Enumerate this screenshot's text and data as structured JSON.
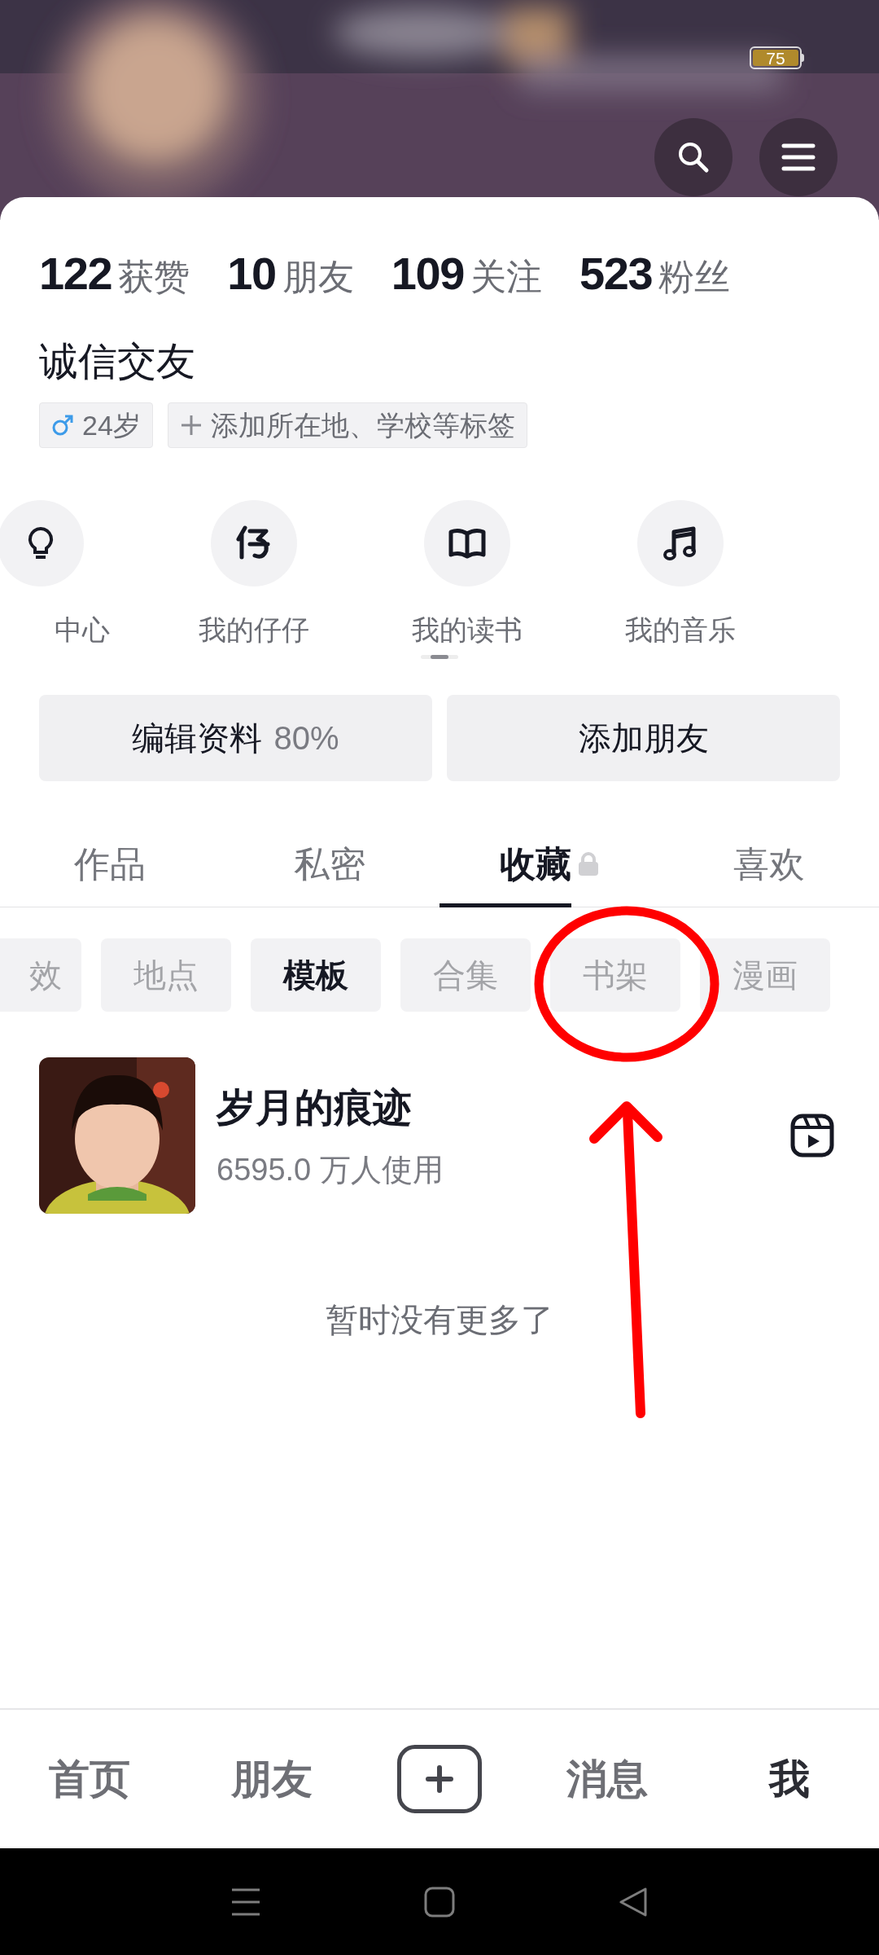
{
  "status_bar": {
    "battery": "75"
  },
  "stats": [
    {
      "count": "122",
      "caption": "获赞"
    },
    {
      "count": "10",
      "caption": "朋友"
    },
    {
      "count": "109",
      "caption": "关注"
    },
    {
      "count": "523",
      "caption": "粉丝"
    }
  ],
  "nickname": "诚信交友",
  "tags": [
    {
      "kind": "gender",
      "text": "24岁"
    },
    {
      "kind": "add",
      "text": "添加所在地、学校等标签"
    }
  ],
  "shortcuts": [
    {
      "kind": "bulb",
      "label": "中心"
    },
    {
      "kind": "zai",
      "label": "我的仔仔"
    },
    {
      "kind": "book",
      "label": "我的读书"
    },
    {
      "kind": "music",
      "label": "我的音乐"
    }
  ],
  "profile_buttons": [
    {
      "label": "编辑资料",
      "extra": "80%"
    },
    {
      "label": "添加朋友"
    }
  ],
  "tabs": [
    {
      "label": "作品",
      "selected": false,
      "locked": false
    },
    {
      "label": "私密",
      "selected": false,
      "locked": false
    },
    {
      "label": "收藏",
      "selected": true,
      "locked": true
    },
    {
      "label": "喜欢",
      "selected": false,
      "locked": false
    }
  ],
  "filters": [
    {
      "label": "效",
      "selected": false
    },
    {
      "label": "地点",
      "selected": false
    },
    {
      "label": "模板",
      "selected": true
    },
    {
      "label": "合集",
      "selected": false
    },
    {
      "label": "书架",
      "selected": false
    },
    {
      "label": "漫画",
      "selected": false
    }
  ],
  "items": [
    {
      "kind": "picture",
      "title": "岁月的痕迹",
      "subtitle": "6595.0 万人使用"
    }
  ],
  "end_note": "暂时没有更多了",
  "bottom_nav": [
    {
      "kind": "tab",
      "label": "首页",
      "selected": false
    },
    {
      "kind": "tab",
      "label": "朋友",
      "selected": false
    },
    {
      "kind": "create"
    },
    {
      "kind": "tab",
      "label": "消息",
      "selected": false
    },
    {
      "kind": "tab",
      "label": "我",
      "selected": true
    }
  ]
}
